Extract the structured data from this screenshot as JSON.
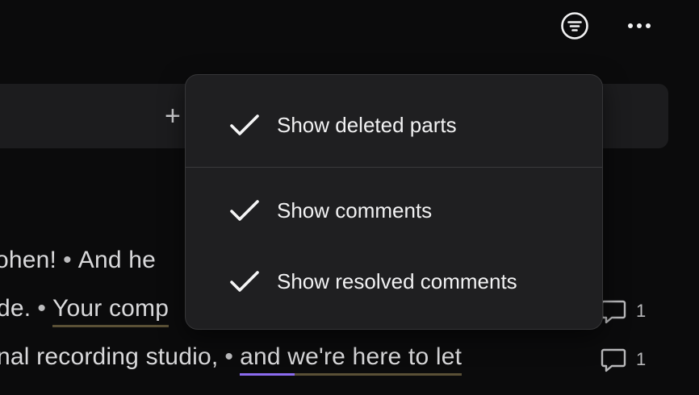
{
  "header": {
    "filter_icon": "filter-circle-icon",
    "more_icon": "more-horizontal-icon"
  },
  "add_bar": {
    "icon": "plus-icon",
    "symbol": "+"
  },
  "transcript": {
    "line1": {
      "a": "ohen!",
      "b": "And he"
    },
    "line2": {
      "a": "de.",
      "b": "Your comp"
    },
    "line3": {
      "a": "nal recording studio,",
      "b": "and we're here to let"
    }
  },
  "comments": [
    {
      "icon": "comment-icon",
      "count": "1"
    },
    {
      "icon": "comment-icon",
      "count": "1"
    }
  ],
  "filter_menu": {
    "items": [
      {
        "label": "Show deleted parts",
        "checked": true
      },
      {
        "label": "Show comments",
        "checked": true
      },
      {
        "label": "Show resolved comments",
        "checked": true
      }
    ]
  },
  "colors": {
    "background": "#0b0b0c",
    "menu_bg": "#1f1f21",
    "accent_purple": "#8c6cf0",
    "underline_gold": "#5a5036"
  }
}
